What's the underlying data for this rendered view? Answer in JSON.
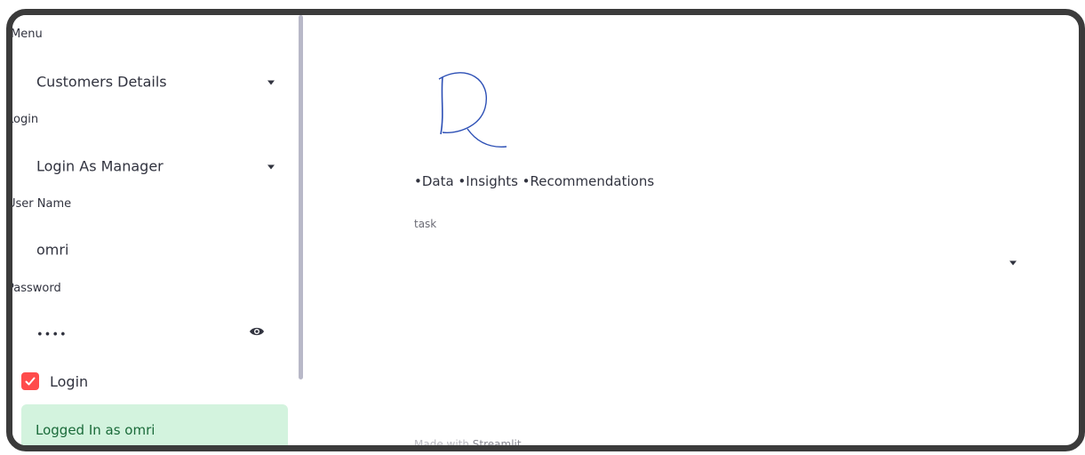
{
  "sidebar": {
    "menu_label": "Menu",
    "menu_value": "Customers Details",
    "login_label": "Login",
    "login_value": "Login As Manager",
    "username_label": "User Name",
    "username_value": "omri",
    "password_label": "Password",
    "password_value": "••••",
    "checkbox_label": "Login",
    "checkbox_checked": true,
    "success_message": "Logged In as omri"
  },
  "main": {
    "tagline": "•Data •Insights •Recommendations",
    "task_label": "task",
    "task_value": "",
    "footer_prefix": "Made with ",
    "footer_brand": "Streamlit"
  },
  "colors": {
    "accent": "#ff4b4b",
    "success_bg": "#d3f3de",
    "logo": "#2c4fb5"
  },
  "icons": {
    "dropdown": "chevron-down-icon",
    "password_toggle": "eye-icon",
    "checkbox": "check-icon"
  }
}
